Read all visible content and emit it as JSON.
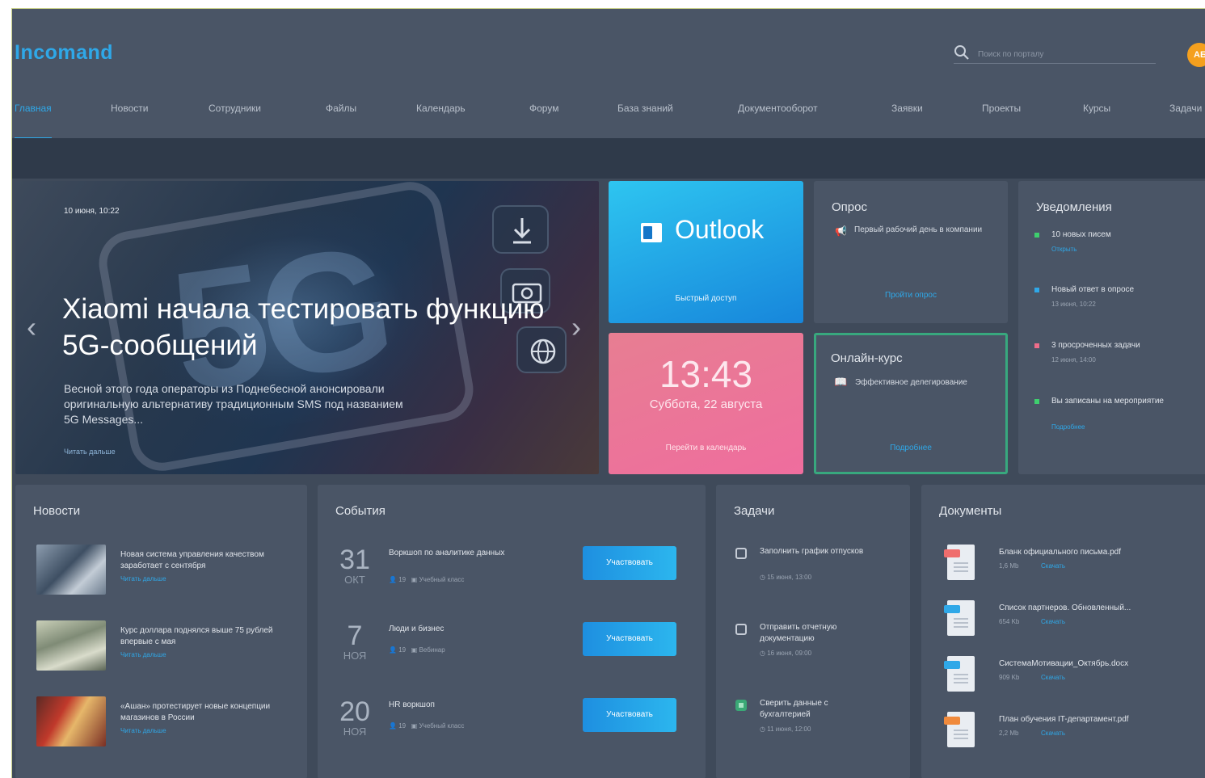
{
  "brand": {
    "logo": "Incomand",
    "accent": "#2fa8e8"
  },
  "search": {
    "placeholder": "Поиск по порталу"
  },
  "user": {
    "avatar_initials": "АБ"
  },
  "nav": [
    {
      "label": "Главная",
      "active": true
    },
    {
      "label": "Новости"
    },
    {
      "label": "Сотрудники"
    },
    {
      "label": "Файлы"
    },
    {
      "label": "Календарь"
    },
    {
      "label": "Форум"
    },
    {
      "label": "База знаний"
    },
    {
      "label": "Документооборот"
    },
    {
      "label": "Заявки"
    },
    {
      "label": "Проекты"
    },
    {
      "label": "Курсы"
    },
    {
      "label": "Задачи"
    }
  ],
  "hero": {
    "date": "10 июня, 10:22",
    "title": "Xiaomi начала тестировать функцию 5G-сообщений",
    "description": "Весной этого года операторы из Поднебесной анонсировали оригинальную альтернативу традиционным SMS под названием 5G Messages...",
    "read_more": "Читать дальше",
    "image_text": "5G"
  },
  "outlook": {
    "name": "Outlook",
    "subtitle": "Быстрый доступ"
  },
  "clock": {
    "time": "13:43",
    "date": "Суббота, 22 августа",
    "link": "Перейти в календарь"
  },
  "poll": {
    "title": "Опрос",
    "question": "Первый рабочий день в компании",
    "link": "Пройти опрос"
  },
  "course": {
    "title": "Онлайн-курс",
    "name": "Эффективное делегирование",
    "link": "Подробнее"
  },
  "notifications": {
    "title": "Уведомления",
    "items": [
      {
        "text": "10 новых писем",
        "meta": "Открыть",
        "meta_is_link": true,
        "color": "#3ecf6e"
      },
      {
        "text": "Новый ответ в опросе",
        "meta": "13 июня, 10:22",
        "meta_is_link": false,
        "color": "#2fa8e8"
      },
      {
        "text": "3 просроченных задачи",
        "meta": "12 июня, 14:00",
        "meta_is_link": false,
        "color": "#ef6d8a"
      },
      {
        "text": "Вы записаны на мероприятие",
        "meta": "Подробнее",
        "meta_is_link": true,
        "color": "#3ecf6e"
      }
    ]
  },
  "news": {
    "title": "Новости",
    "items": [
      {
        "text": "Новая система управления качеством заработает с сентября",
        "link": "Читать дальше"
      },
      {
        "text": "Курс доллара поднялся выше 75 рублей впервые с мая",
        "link": "Читать дальше"
      },
      {
        "text": "«Ашан» протестирует новые концепции магазинов в России",
        "link": "Читать дальше"
      }
    ]
  },
  "events": {
    "title": "События",
    "items": [
      {
        "day": "31",
        "month": "ОКТ",
        "title": "Воркшоп по аналитике данных",
        "people": "19",
        "place": "Учебный класс",
        "button": "Участвовать"
      },
      {
        "day": "7",
        "month": "НОЯ",
        "title": "Люди и бизнес",
        "people": "19",
        "place": "Вебинар",
        "button": "Участвовать"
      },
      {
        "day": "20",
        "month": "НОЯ",
        "title": "HR воркшоп",
        "people": "19",
        "place": "Учебный класс",
        "button": "Участвовать"
      }
    ]
  },
  "tasks": {
    "title": "Задачи",
    "items": [
      {
        "text": "Заполнить график отпусков",
        "due": "15 июня, 13:00",
        "done": false
      },
      {
        "text": "Отправить отчетную документацию",
        "due": "16 июня, 09:00",
        "done": false
      },
      {
        "text": "Сверить данные с бухгалтерией",
        "due": "11 июня, 12:00",
        "done": true
      }
    ]
  },
  "documents": {
    "title": "Документы",
    "items": [
      {
        "name": "Бланк официального письма.pdf",
        "size": "1,6 Mb",
        "link": "Скачать",
        "type_color": "#ef6d6d"
      },
      {
        "name": "Список партнеров. Обновленный...",
        "size": "654 Kb",
        "link": "Скачать",
        "type_color": "#2fa8e8"
      },
      {
        "name": "СистемаМотивации_Октябрь.docx",
        "size": "909 Kb",
        "link": "Скачать",
        "type_color": "#2fa8e8"
      },
      {
        "name": "План обучения IT-департамент.pdf",
        "size": "2,2 Mb",
        "link": "Скачать",
        "type_color": "#f08a3c"
      }
    ]
  }
}
